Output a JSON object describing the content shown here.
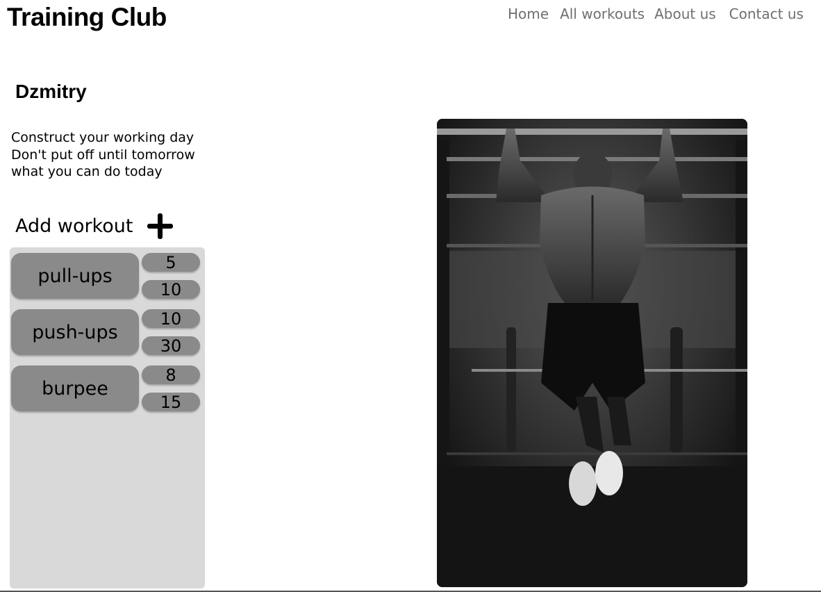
{
  "header": {
    "logo": "Training Club",
    "nav": [
      "Home",
      "All workouts",
      "About us",
      "Contact us"
    ]
  },
  "user": {
    "name": "Dzmitry"
  },
  "quote": [
    "Construct your working day",
    "Don't put off until tomorrow",
    "what you can do today"
  ],
  "add_workout": {
    "label": "Add workout",
    "icon": "plus-icon"
  },
  "workouts": [
    {
      "name": "pull-ups",
      "values": [
        "5",
        "10"
      ]
    },
    {
      "name": "push-ups",
      "values": [
        "10",
        "30"
      ]
    },
    {
      "name": "burpee",
      "values": [
        "8",
        "15"
      ]
    }
  ],
  "photo": {
    "alt": "athlete doing pull-ups"
  },
  "colors": {
    "chip": "#8a8a8a",
    "panel": "#d9d9d9",
    "nav": "#6f6f6f"
  }
}
